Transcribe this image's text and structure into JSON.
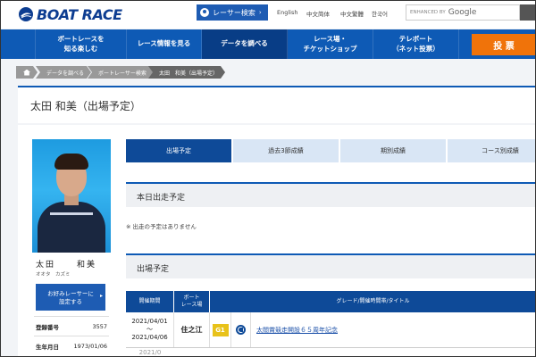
{
  "header": {
    "logo_text": "BOAT RACE",
    "racer_search_label": "レーサー検索",
    "languages": [
      "English",
      "中文简体",
      "中文繁體",
      "한국어"
    ],
    "google_prefix": "ENHANCED BY",
    "google_brand": "Google"
  },
  "nav": {
    "items": [
      {
        "label": "ボートレースを\n知る楽しむ"
      },
      {
        "label": "レース情報を見る"
      },
      {
        "label": "データを調べる"
      },
      {
        "label": "レース場・\nチケットショップ"
      },
      {
        "label": "テレボート\n（ネット投票）"
      }
    ],
    "active_index": 2,
    "vote_label": "投 票"
  },
  "breadcrumb": [
    "データを調べる",
    "ボートレーサー検索",
    "太田　和美（出場予定）"
  ],
  "page_title": "太田 和美（出場予定）",
  "profile": {
    "family_name": "太田",
    "given_name": "和美",
    "kana": "オオタ　カズミ",
    "favorite_button": "お好みレーサーに\n設定する",
    "info": [
      {
        "key": "登録番号",
        "value": "3557"
      },
      {
        "key": "生年月日",
        "value": "1973/01/06"
      }
    ]
  },
  "tabs": [
    "出場予定",
    "過去3節成績",
    "期別成績",
    "コース別成績"
  ],
  "active_tab": 0,
  "today": {
    "heading": "本日出走予定",
    "note": "※ 出走の予定はありません"
  },
  "schedule": {
    "heading": "出場予定",
    "columns": [
      "開催期間",
      "ボート\nレース場",
      "グレード/開催時間帯/タイトル"
    ],
    "rows": [
      {
        "start": "2021/04/01",
        "sep": "～",
        "end": "2021/04/06",
        "venue": "住之江",
        "grade": "G1",
        "time_icon": "daytime-icon",
        "title": "太閤賞競走開設６５周年記念"
      }
    ],
    "next_row_fragment": "2021/0"
  },
  "colors": {
    "brand_blue": "#0e5ab5",
    "dark_blue": "#0e4a98",
    "vote_orange": "#f0730a",
    "g1_gold": "#e8c21a"
  }
}
